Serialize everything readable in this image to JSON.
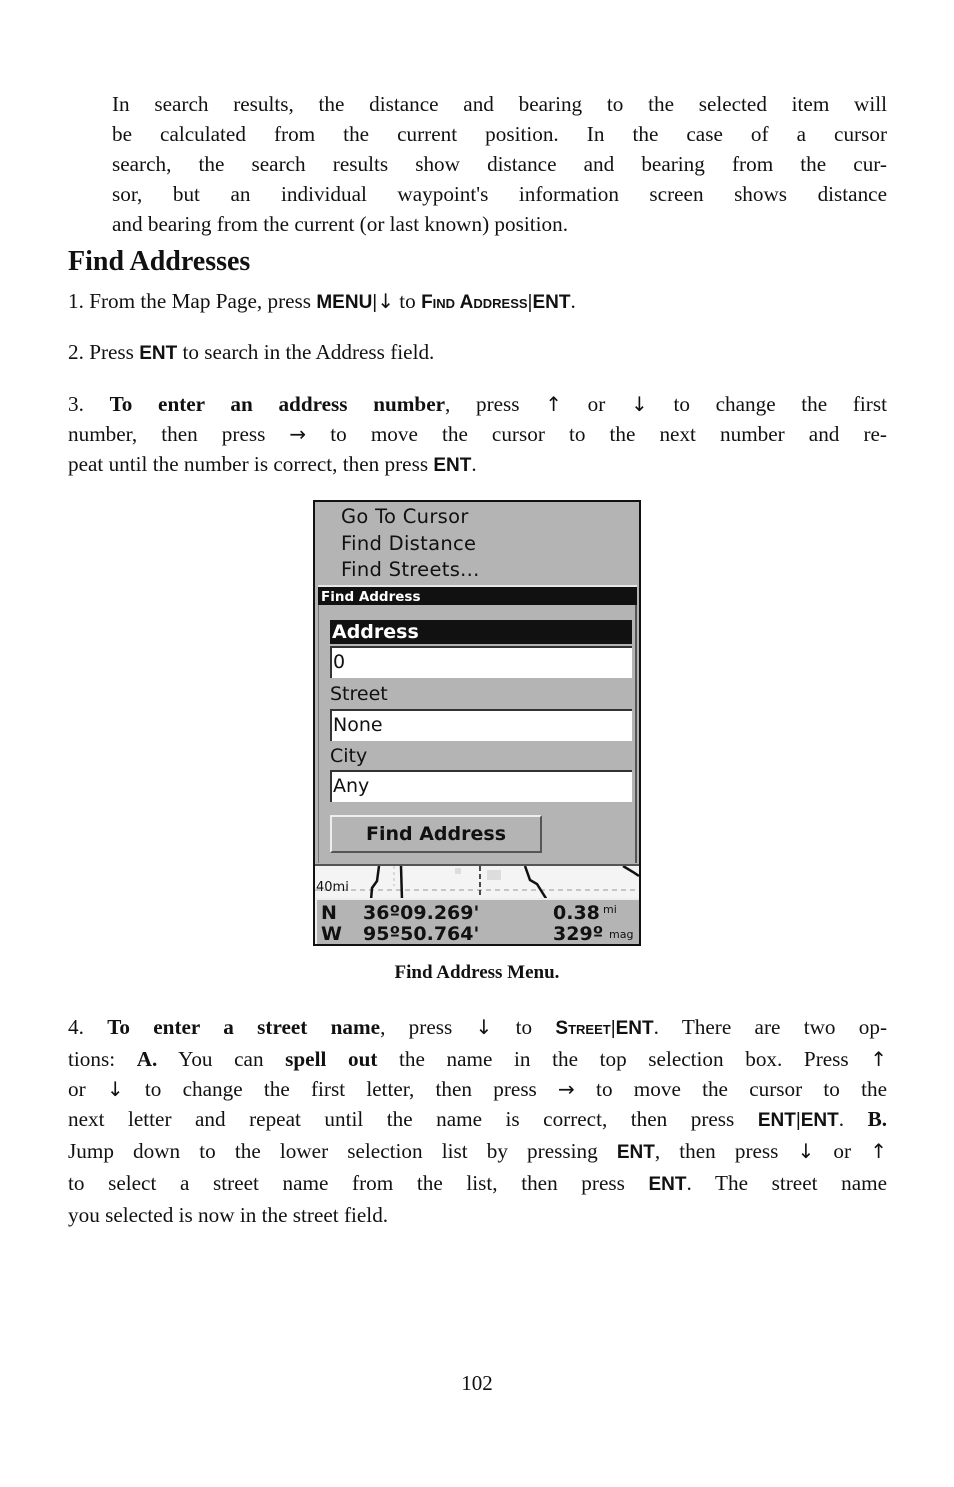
{
  "intro_paragraph": {
    "lines": [
      "In search results, the distance and bearing to the selected item will",
      "be calculated from the current position. In the case of a cursor",
      "search, the search results show distance and bearing from the cur-",
      "sor, but an individual waypoint's information screen shows distance",
      "and bearing from the current (or last known) position."
    ]
  },
  "section_title": "Find Addresses",
  "step1": {
    "prefix": "1. From the Map Page, press ",
    "key_menu": "MENU",
    "sep": "|",
    "arrow_down": "↓",
    "to": " to ",
    "menu_item": "Find Address",
    "key_ent": "ENT",
    "end": "."
  },
  "step2": {
    "prefix": "2. Press ",
    "key_ent": "ENT",
    "suffix": " to search in the Address field."
  },
  "step3": {
    "num": "3. ",
    "bold": "To enter an address number",
    "l1_a": ", press ",
    "arrow_up": "↑",
    "l1_b": " or ",
    "arrow_down": "↓",
    "l1_c": " to change the first",
    "l2_a": "number, then press ",
    "arrow_right": "→",
    "l2_b": " to move the cursor to the next number and re-",
    "l3_a": "peat until the number is correct, then press ",
    "key_ent": "ENT",
    "l3_b": "."
  },
  "device_screen": {
    "menu_items": [
      "Go To Cursor",
      "Find Distance",
      "Find Streets..."
    ],
    "dialog_title": "Find Address",
    "fields": [
      {
        "label": "Address",
        "value": "0",
        "selected": true
      },
      {
        "label": "Street",
        "value": "None",
        "selected": false
      },
      {
        "label": "City",
        "value": "Any",
        "selected": false
      }
    ],
    "button_label": "Find Address",
    "map_scale": "40mi",
    "status": {
      "lat_hemi": "N",
      "lat": "36º09.269'",
      "lon_hemi": "W",
      "lon": "95º50.764'",
      "distance": "0.38",
      "distance_unit": "mi",
      "bearing": "329º",
      "bearing_unit": "mag"
    }
  },
  "figure_caption": "Find Address Menu.",
  "step4": {
    "num": "4. ",
    "bold": "To enter a street name",
    "l1_a": ", press ",
    "arrow_down": "↓",
    "l1_b": " to ",
    "menu_item": "Street",
    "sep": "|",
    "key_ent": "ENT",
    "l1_c": ". There are two op-",
    "l2_a": "tions: ",
    "opt_a": "A.",
    "l2_b": " You can ",
    "spell_out": "spell out",
    "l2_c": " the name in the top selection box. Press ",
    "arrow_up": "↑",
    "l3_a": "or ",
    "l3_b": " to change the first letter, then press ",
    "arrow_right": "→",
    "l3_c": " to move the cursor to the",
    "l4_a": "next letter and repeat until the name is correct, then press ",
    "l4_b": ". ",
    "opt_b": "B.",
    "l5_a": "Jump down to the lower selection list by pressing ",
    "l5_b": ", then press ",
    "l5_c": " or ",
    "l6_a": "to select a street name from the list, then press ",
    "l6_b": ". The street name",
    "l7": "you selected is now in the street field."
  },
  "page_number": "102"
}
